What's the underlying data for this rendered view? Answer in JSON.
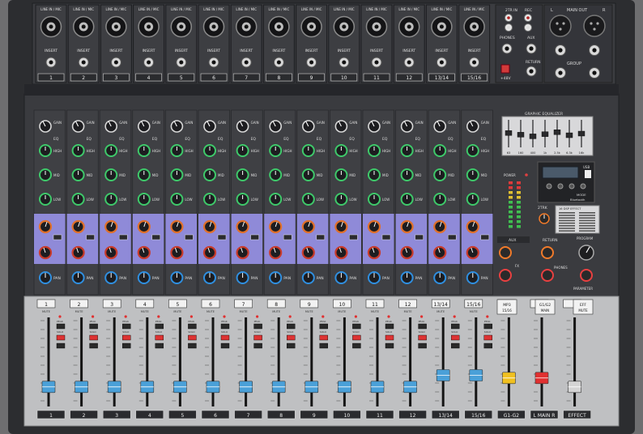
{
  "top_panel": {
    "mono_channels": [
      {
        "input_label": "LINE IN / MIC",
        "insert_label": "INSERT",
        "number": "1"
      },
      {
        "input_label": "LINE IN / MIC",
        "insert_label": "INSERT",
        "number": "2"
      },
      {
        "input_label": "LINE IN / MIC",
        "insert_label": "INSERT",
        "number": "3"
      },
      {
        "input_label": "LINE IN / MIC",
        "insert_label": "INSERT",
        "number": "4"
      },
      {
        "input_label": "LINE IN / MIC",
        "insert_label": "INSERT",
        "number": "5"
      },
      {
        "input_label": "LINE IN / MIC",
        "insert_label": "INSERT",
        "number": "6"
      },
      {
        "input_label": "LINE IN / MIC",
        "insert_label": "INSERT",
        "number": "7"
      },
      {
        "input_label": "LINE IN / MIC",
        "insert_label": "INSERT",
        "number": "8"
      },
      {
        "input_label": "LINE IN / MIC",
        "insert_label": "INSERT",
        "number": "9"
      },
      {
        "input_label": "LINE IN / MIC",
        "insert_label": "INSERT",
        "number": "10"
      },
      {
        "input_label": "LINE IN / MIC",
        "insert_label": "INSERT",
        "number": "11"
      },
      {
        "input_label": "LINE IN / MIC",
        "insert_label": "INSERT",
        "number": "12"
      }
    ],
    "stereo_channels": [
      {
        "input_label": "LINE IN / MIC",
        "insert_label": "INSERT",
        "number": "13/14"
      },
      {
        "input_label": "LINE IN / MIC",
        "insert_label": "INSERT",
        "number": "15/16"
      }
    ],
    "io": {
      "label_2trk_in": "2TR IN",
      "label_rec": "REC",
      "label_phones": "PHONES",
      "label_aux": "AUX",
      "label_return": "RETURN",
      "label_phantom": "+48V"
    },
    "main": {
      "label_main_out": "MAIN OUT",
      "label_l": "L",
      "label_r": "R",
      "label_group": "GROUP"
    }
  },
  "strip_labels": {
    "gain": "GAIN",
    "eq": "EQ",
    "high": "HIGH",
    "mid": "MID",
    "low": "LOW",
    "pan": "PAN",
    "mute": "MUTE",
    "peak": "PEAK",
    "solo": "SOLO"
  },
  "strips": [
    "1",
    "2",
    "3",
    "4",
    "5",
    "6",
    "7",
    "8",
    "9",
    "10",
    "11",
    "12",
    "13/14",
    "15/16"
  ],
  "master": {
    "geq_title": "GRAPHIC EQUALIZER",
    "geq_bands": [
      "63",
      "160",
      "400",
      "1k",
      "2.5k",
      "6.3k",
      "16k"
    ],
    "geq_levels": [
      0.52,
      0.46,
      0.4,
      0.48,
      0.55,
      0.44,
      0.5
    ],
    "power_label": "POWER",
    "usb_label": "USB",
    "bluetooth_label": "Bluetooth",
    "mode_label": "MODE",
    "label_2trk": "2TRK",
    "effects_title": "16 DSP EFFECT",
    "aux_label": "AUX",
    "return_label": "RETURN",
    "phones_label": "PHONES",
    "program_label": "PROGRAM",
    "parameter_label": "PARAMETER",
    "fx_label": "FX"
  },
  "bottom_buttons": [
    {
      "top": "MP3",
      "bottom": "15/16"
    },
    {
      "top": "G1/G2",
      "bottom": "MAIN"
    },
    {
      "top": "EFF",
      "bottom": "MUTE"
    }
  ],
  "fader_labels": [
    "1",
    "2",
    "3",
    "4",
    "5",
    "6",
    "7",
    "8",
    "9",
    "10",
    "11",
    "12",
    "13/14",
    "15/16",
    "G1-G2",
    "L  MAIN  R",
    "EFFECT"
  ],
  "colors": {
    "chassis": "#3a3b3e",
    "strip_face": "#3f4044",
    "aux_band": "#8f8ad8",
    "aux_knob_orange": "#e0702a",
    "aux_knob_red": "#c83a2a",
    "eq_knob_green": "#3ec96a",
    "pan_knob_blue": "#2f8fe0",
    "fader_section": "#bfc0c2",
    "fader_cap_blue": "#4aa0d8",
    "fader_cap_yellow": "#f0c020",
    "fader_cap_red": "#e03030",
    "fader_cap_grey": "#d4d4d4"
  },
  "fader_levels": [
    0.22,
    0.22,
    0.22,
    0.22,
    0.22,
    0.22,
    0.22,
    0.22,
    0.22,
    0.22,
    0.22,
    0.22,
    0.35,
    0.35,
    0.32,
    0.32,
    0.22
  ]
}
